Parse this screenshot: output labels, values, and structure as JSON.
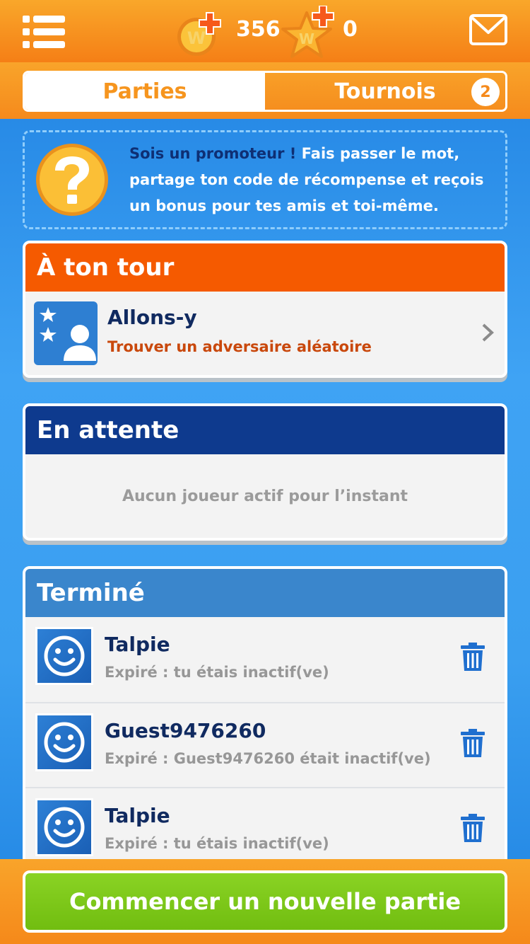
{
  "header": {
    "coins": "356",
    "stars": "0"
  },
  "tabs": [
    {
      "label": "Parties",
      "active": true
    },
    {
      "label": "Tournois",
      "active": false,
      "badge": "2"
    }
  ],
  "promo": {
    "highlight": "Sois un promoteur !",
    "text": " Fais passer le mot, partage ton code de récompense et reçois un bonus pour tes amis et toi-même."
  },
  "your_turn": {
    "title": "À ton tour",
    "item": {
      "name": "Allons-y",
      "subtitle": "Trouver un adversaire aléatoire"
    }
  },
  "waiting": {
    "title": "En attente",
    "empty_text": "Aucun joueur actif pour l’instant"
  },
  "finished": {
    "title": "Terminé",
    "items": [
      {
        "name": "Talpie",
        "status": "Expiré : tu étais inactif(ve)"
      },
      {
        "name": "Guest9476260",
        "status": "Expiré : Guest9476260 était inactif(ve)"
      },
      {
        "name": "Talpie",
        "status": "Expiré : tu étais inactif(ve)"
      }
    ]
  },
  "new_game_label": "Commencer un nouvelle partie",
  "colors": {
    "orange": "#f57f16",
    "your_turn_header": "#f55a00",
    "waiting_header": "#0e3a8e",
    "finished_header": "#3a86cc",
    "green_button": "#7ec81a"
  },
  "icons": [
    "menu-icon",
    "coin-icon",
    "star-icon",
    "mail-icon",
    "question-icon",
    "random-opponent-icon",
    "smiley-avatar-icon",
    "trash-icon",
    "chevron-right-icon"
  ]
}
